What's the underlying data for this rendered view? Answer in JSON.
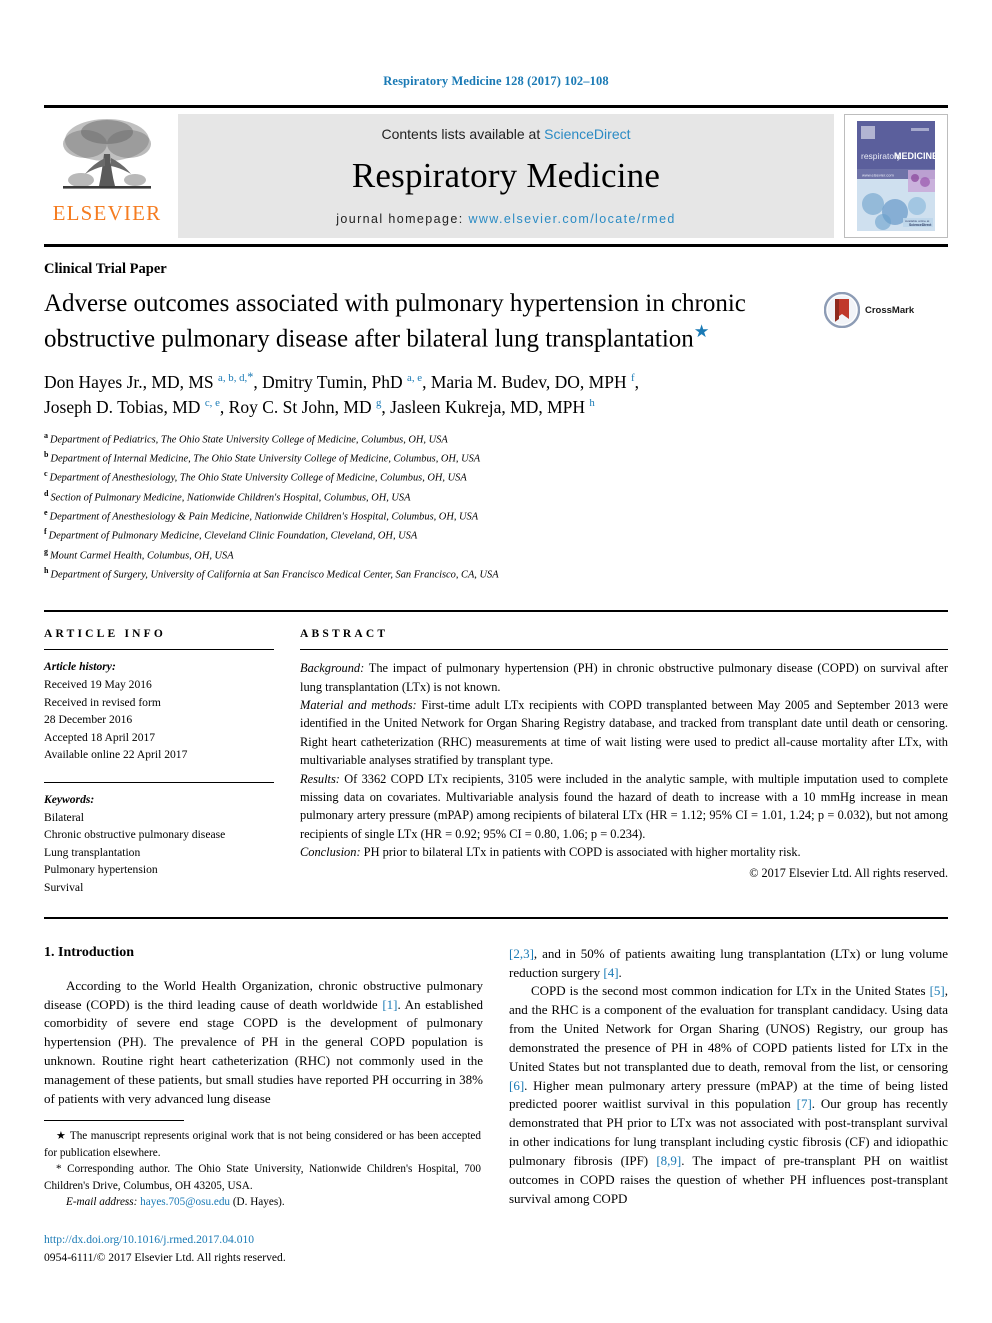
{
  "running_head": "Respiratory Medicine 128 (2017) 102–108",
  "masthead": {
    "contents_prefix": "Contents lists available at ",
    "sciencedirect": "ScienceDirect",
    "journal_name": "Respiratory Medicine",
    "homepage_prefix": "journal homepage: ",
    "homepage_url": "www.elsevier.com/locate/rmed",
    "publisher_wordmark": "ELSEVIER",
    "publisher_logo_icon": "elsevier-tree-icon",
    "cover_icon": "journal-cover-thumbnail",
    "cover_title": "respiratory MEDICINE",
    "accent_blue": "#1a7ab5",
    "link_blue": "#2b8bc4",
    "elsevier_orange": "#F57C20",
    "band_gray": "#e6e6e6"
  },
  "article": {
    "type": "Clinical Trial Paper",
    "title_line1": "Adverse outcomes associated with pulmonary hypertension in chronic",
    "title_line2": "obstructive pulmonary disease after bilateral lung transplantation",
    "title_star": "★",
    "crossmark_label": "CrossMark",
    "crossmark_icon": "crossmark-badge-icon",
    "authors": [
      {
        "name": "Don Hayes Jr., MD, MS",
        "marks": "a, b, d,",
        "star": "*",
        "sep": ", "
      },
      {
        "name": "Dmitry Tumin, PhD",
        "marks": "a, e",
        "star": "",
        "sep": ", "
      },
      {
        "name": "Maria M. Budev, DO, MPH",
        "marks": "f",
        "star": "",
        "sep": ", "
      },
      {
        "name": "Joseph D. Tobias, MD",
        "marks": "c, e",
        "star": "",
        "sep": ", "
      },
      {
        "name": "Roy C. St John, MD",
        "marks": "g",
        "star": "",
        "sep": ", "
      },
      {
        "name": "Jasleen Kukreja, MD, MPH",
        "marks": "h",
        "star": "",
        "sep": ""
      }
    ],
    "affiliations": [
      {
        "mark": "a",
        "text": "Department of Pediatrics, The Ohio State University College of Medicine, Columbus, OH, USA"
      },
      {
        "mark": "b",
        "text": "Department of Internal Medicine, The Ohio State University College of Medicine, Columbus, OH, USA"
      },
      {
        "mark": "c",
        "text": "Department of Anesthesiology, The Ohio State University College of Medicine, Columbus, OH, USA"
      },
      {
        "mark": "d",
        "text": "Section of Pulmonary Medicine, Nationwide Children's Hospital, Columbus, OH, USA"
      },
      {
        "mark": "e",
        "text": "Department of Anesthesiology & Pain Medicine, Nationwide Children's Hospital, Columbus, OH, USA"
      },
      {
        "mark": "f",
        "text": "Department of Pulmonary Medicine, Cleveland Clinic Foundation, Cleveland, OH, USA"
      },
      {
        "mark": "g",
        "text": "Mount Carmel Health, Columbus, OH, USA"
      },
      {
        "mark": "h",
        "text": "Department of Surgery, University of California at San Francisco Medical Center, San Francisco, CA, USA"
      }
    ]
  },
  "article_info": {
    "heading": "ARTICLE INFO",
    "history_label": "Article history:",
    "history": [
      "Received 19 May 2016",
      "Received in revised form",
      "28 December 2016",
      "Accepted 18 April 2017",
      "Available online 22 April 2017"
    ],
    "keywords_label": "Keywords:",
    "keywords": [
      "Bilateral",
      "Chronic obstructive pulmonary disease",
      "Lung transplantation",
      "Pulmonary hypertension",
      "Survival"
    ]
  },
  "abstract": {
    "heading": "ABSTRACT",
    "background_label": "Background:",
    "background_text": " The impact of pulmonary hypertension (PH) in chronic obstructive pulmonary disease (COPD) on survival after lung transplantation (LTx) is not known.",
    "methods_label": "Material and methods:",
    "methods_text": " First-time adult LTx recipients with COPD transplanted between May 2005 and September 2013 were identified in the United Network for Organ Sharing Registry database, and tracked from transplant date until death or censoring. Right heart catheterization (RHC) measurements at time of wait listing were used to predict all-cause mortality after LTx, with multivariable analyses stratified by transplant type.",
    "results_label": "Results:",
    "results_text": " Of 3362 COPD LTx recipients, 3105 were included in the analytic sample, with multiple imputation used to complete missing data on covariates. Multivariable analysis found the hazard of death to increase with a 10 mmHg increase in mean pulmonary artery pressure (mPAP) among recipients of bilateral LTx (HR = 1.12; 95% CI = 1.01, 1.24; p = 0.032), but not among recipients of single LTx (HR = 0.92; 95% CI = 0.80, 1.06; p = 0.234).",
    "conclusion_label": "Conclusion:",
    "conclusion_text": " PH prior to bilateral LTx in patients with COPD is associated with higher mortality risk.",
    "copyright": "© 2017 Elsevier Ltd. All rights reserved."
  },
  "introduction": {
    "heading": "1. Introduction",
    "left_para_1_a": "According to the World Health Organization, chronic obstructive pulmonary disease (COPD) is the third leading cause of death worldwide ",
    "left_ref_1": "[1]",
    "left_para_1_b": ". An established comorbidity of severe end stage COPD is the development of pulmonary hypertension (PH). The prevalence of PH in the general COPD population is unknown. Routine right heart catheterization (RHC) not commonly used in the management of these patients, but small studies have reported PH occurring in 38% of patients with very advanced lung disease ",
    "right_ref_23": "[2,3]",
    "right_para_1_a": ", and in 50% of patients awaiting lung transplantation (LTx) or lung volume reduction surgery ",
    "right_ref_4": "[4]",
    "right_para_1_b": ".",
    "right_para_2_a": "COPD is the second most common indication for LTx in the United States ",
    "right_ref_5": "[5]",
    "right_para_2_b": ", and the RHC is a component of the evaluation for transplant candidacy. Using data from the United Network for Organ Sharing (UNOS) Registry, our group has demonstrated the presence of PH in 48% of COPD patients listed for LTx in the United States but not transplanted due to death, removal from the list, or censoring ",
    "right_ref_6": "[6]",
    "right_para_2_c": ". Higher mean pulmonary artery pressure (mPAP) at the time of being listed predicted poorer waitlist survival in this population ",
    "right_ref_7": "[7]",
    "right_para_2_d": ". Our group has recently demonstrated that PH prior to LTx was not associated with post-transplant survival in other indications for lung transplant including cystic fibrosis (CF) and idiopathic pulmonary fibrosis (IPF) ",
    "right_ref_89": "[8,9]",
    "right_para_2_e": ". The impact of pre-transplant PH on waitlist outcomes in COPD raises the question of whether PH influences post-transplant survival among COPD"
  },
  "footnotes": {
    "star_note": "★ The manuscript represents original work that is not being considered or has been accepted for publication elsewhere.",
    "corresponding_note": "* Corresponding author. The Ohio State University, Nationwide Children's Hospital, 700 Children's Drive, Columbus, OH 43205, USA.",
    "email_label": "E-mail address:",
    "email": "hayes.705@osu.edu",
    "email_suffix": " (D. Hayes).",
    "doi": "http://dx.doi.org/10.1016/j.rmed.2017.04.010",
    "issn_line": "0954-6111/© 2017 Elsevier Ltd. All rights reserved."
  }
}
